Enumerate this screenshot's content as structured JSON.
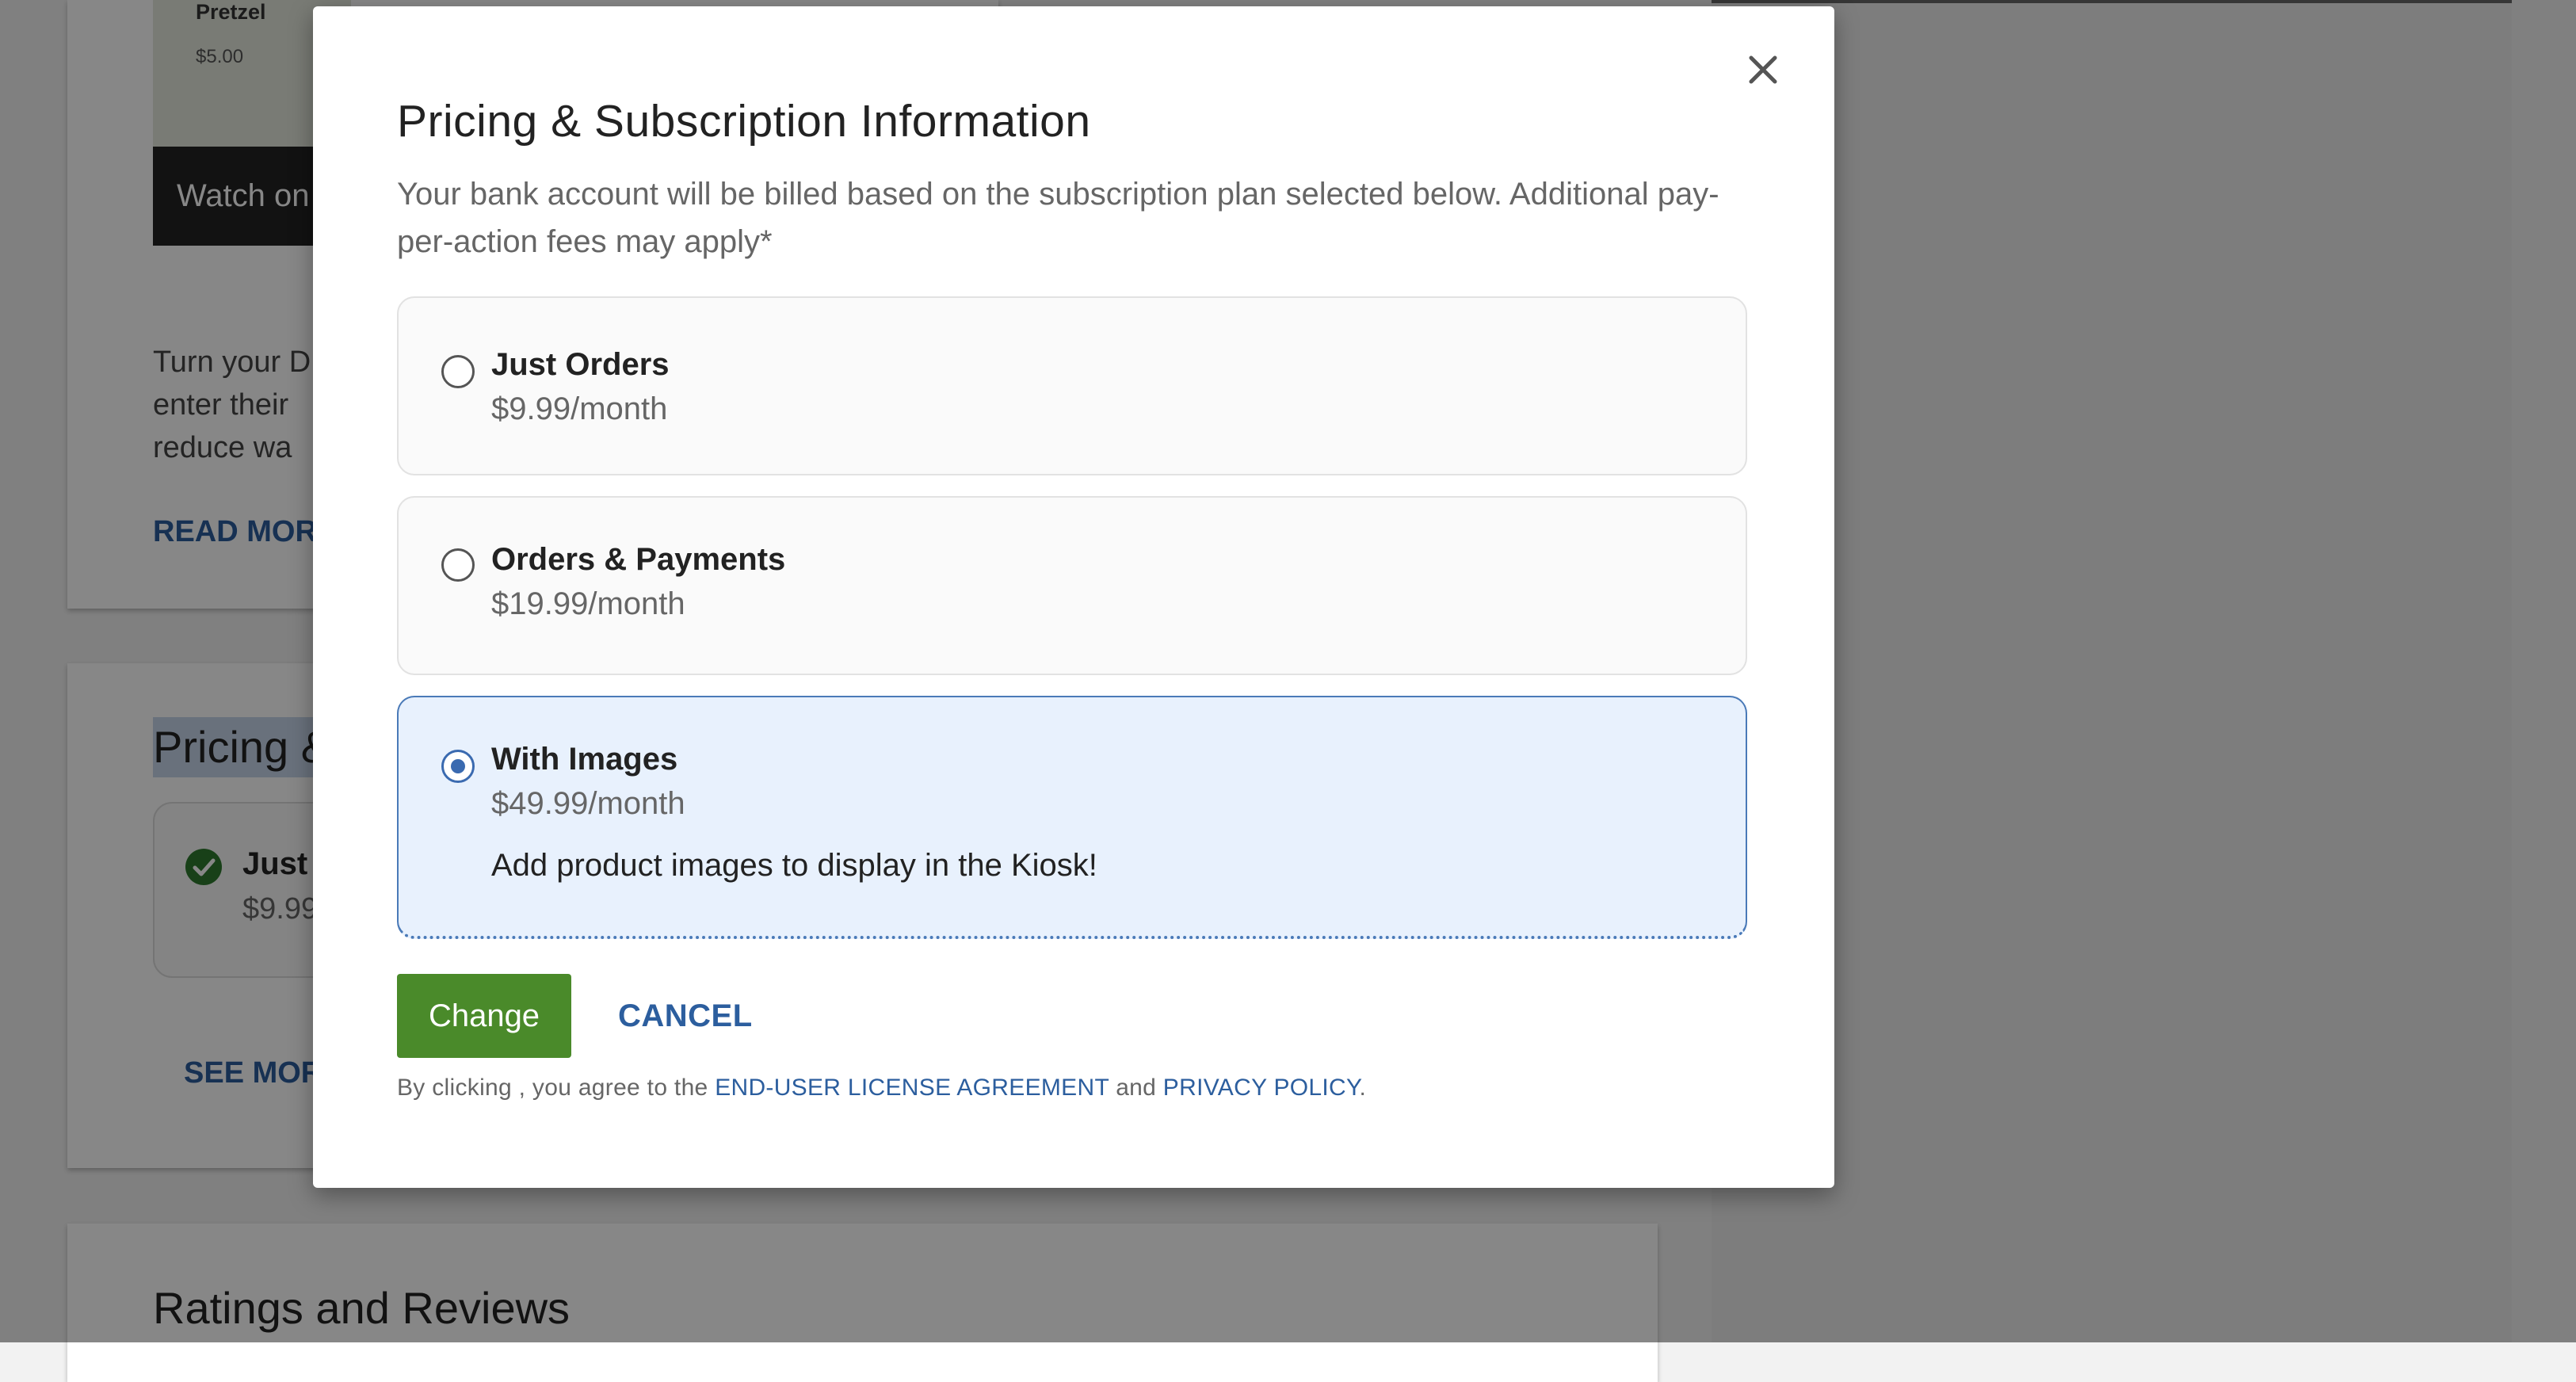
{
  "background": {
    "thumbnail": {
      "name": "Pretzel",
      "price": "$5.00"
    },
    "watch_button": "Watch on",
    "description_lines": [
      "Turn your D",
      "enter their",
      "reduce wa"
    ],
    "read_more": "READ MORE",
    "pricing_heading": "Pricing &",
    "current_plan": {
      "name": "Just",
      "price": "$9.99"
    },
    "see_more": "SEE MORE",
    "ratings_title": "Ratings and Reviews"
  },
  "modal": {
    "title": "Pricing & Subscription Information",
    "subtitle": "Your bank account will be billed based on the subscription plan selected below. Additional pay-per-action fees may apply*",
    "options": [
      {
        "name": "Just Orders",
        "price": "$9.99/month",
        "selected": false
      },
      {
        "name": "Orders & Payments",
        "price": "$19.99/month",
        "selected": false
      },
      {
        "name": "With Images",
        "price": "$49.99/month",
        "description": "Add product images to display in the Kiosk!",
        "selected": true
      }
    ],
    "change_label": "Change",
    "cancel_label": "CANCEL",
    "legal": {
      "prefix": "By clicking , you agree to the",
      "eula": "END-USER LICENSE AGREEMENT",
      "and": "and",
      "privacy": "PRIVACY POLICY",
      "suffix": "."
    }
  },
  "colors": {
    "accent_blue": "#2c5e9e",
    "change_green": "#4a8a2a",
    "selected_bg": "#e8f1fd",
    "check_green": "#2f7a2f"
  }
}
